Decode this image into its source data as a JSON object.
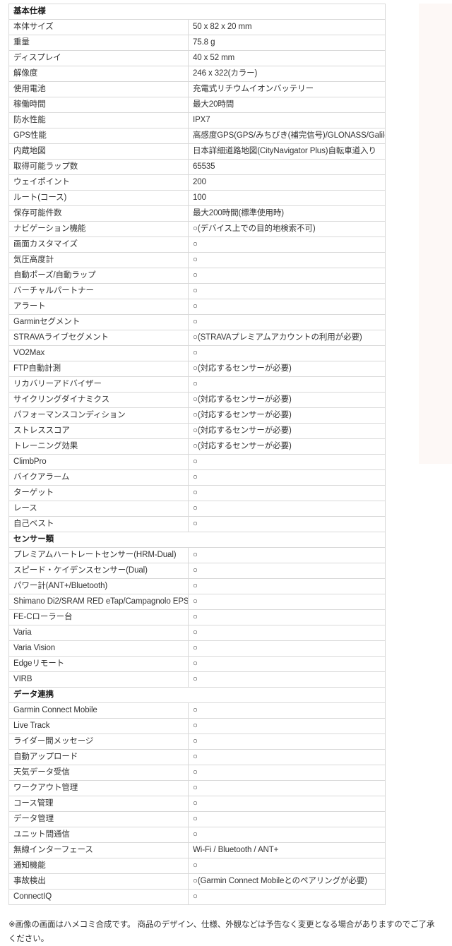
{
  "table": {
    "sections": [
      {
        "header": "基本仕様",
        "rows": [
          {
            "label": "本体サイズ",
            "value": "50 x 82 x 20 mm"
          },
          {
            "label": "重量",
            "value": "75.8 g"
          },
          {
            "label": "ディスプレイ",
            "value": "40 x 52 mm"
          },
          {
            "label": "解像度",
            "value": "246 x 322(カラー)"
          },
          {
            "label": "使用電池",
            "value": "充電式リチウムイオンバッテリー"
          },
          {
            "label": "稼働時間",
            "value": "最大20時間"
          },
          {
            "label": "防水性能",
            "value": "IPX7"
          },
          {
            "label": "GPS性能",
            "value": "高感度GPS(GPS/みちびき(補完信号)/GLONASS/Galileo)"
          },
          {
            "label": "内蔵地図",
            "value": "日本詳細道路地図(CityNavigator Plus)自転車道入り"
          },
          {
            "label": "取得可能ラップ数",
            "value": "65535"
          },
          {
            "label": "ウェイポイント",
            "value": "200"
          },
          {
            "label": "ルート(コース)",
            "value": "100"
          },
          {
            "label": "保存可能件数",
            "value": "最大200時間(標準使用時)"
          },
          {
            "label": "ナビゲーション機能",
            "value": "○(デバイス上での目的地検索不可)"
          },
          {
            "label": "画面カスタマイズ",
            "value": "○"
          },
          {
            "label": "気圧高度計",
            "value": "○"
          },
          {
            "label": "自動ポーズ/自動ラップ",
            "value": "○"
          },
          {
            "label": "バーチャルパートナー",
            "value": "○"
          },
          {
            "label": "アラート",
            "value": "○"
          },
          {
            "label": "Garminセグメント",
            "value": "○"
          },
          {
            "label": "STRAVAライブセグメント",
            "value": "○(STRAVAプレミアムアカウントの利用が必要)"
          },
          {
            "label": "VO2Max",
            "value": "○"
          },
          {
            "label": "FTP自動計測",
            "value": "○(対応するセンサーが必要)"
          },
          {
            "label": "リカバリーアドバイザー",
            "value": "○"
          },
          {
            "label": "サイクリングダイナミクス",
            "value": "○(対応するセンサーが必要)"
          },
          {
            "label": "パフォーマンスコンディション",
            "value": "○(対応するセンサーが必要)"
          },
          {
            "label": "ストレススコア",
            "value": "○(対応するセンサーが必要)"
          },
          {
            "label": "トレーニング効果",
            "value": "○(対応するセンサーが必要)"
          },
          {
            "label": "ClimbPro",
            "value": "○"
          },
          {
            "label": "バイクアラーム",
            "value": "○"
          },
          {
            "label": "ターゲット",
            "value": "○"
          },
          {
            "label": "レース",
            "value": "○"
          },
          {
            "label": "自己ベスト",
            "value": "○"
          }
        ]
      },
      {
        "header": "センサー類",
        "rows": [
          {
            "label": "プレミアムハートレートセンサー(HRM-Dual)",
            "value": "○"
          },
          {
            "label": "スピード・ケイデンスセンサー(Dual)",
            "value": "○"
          },
          {
            "label": "パワー計(ANT+/Bluetooth)",
            "value": "○"
          },
          {
            "label": "Shimano Di2/SRAM RED eTap/Campagnolo EPS",
            "value": "○"
          },
          {
            "label": "FE-Cローラー台",
            "value": "○"
          },
          {
            "label": "Varia",
            "value": "○"
          },
          {
            "label": "Varia Vision",
            "value": "○"
          },
          {
            "label": "Edgeリモート",
            "value": "○"
          },
          {
            "label": "VIRB",
            "value": "○"
          }
        ]
      },
      {
        "header": "データ連携",
        "rows": [
          {
            "label": "Garmin Connect Mobile",
            "value": "○"
          },
          {
            "label": "Live Track",
            "value": "○"
          },
          {
            "label": "ライダー間メッセージ",
            "value": "○"
          },
          {
            "label": "自動アップロード",
            "value": "○"
          },
          {
            "label": "天気データ受信",
            "value": "○"
          },
          {
            "label": "ワークアウト管理",
            "value": "○"
          },
          {
            "label": "コース管理",
            "value": "○"
          },
          {
            "label": "データ管理",
            "value": "○"
          },
          {
            "label": "ユニット間通信",
            "value": "○"
          },
          {
            "label": "無線インターフェース",
            "value": "Wi-Fi / Bluetooth / ANT+"
          },
          {
            "label": "通知機能",
            "value": "○"
          },
          {
            "label": "事故検出",
            "value": "○(Garmin Connect Mobileとのペアリングが必要)"
          },
          {
            "label": "ConnectIQ",
            "value": "○"
          }
        ]
      }
    ]
  },
  "footnote": "※画像の画面はハメコミ合成です。 商品のデザイン、仕様、外観などは予告なく変更となる場合がありますのでご了承ください。",
  "colors": {
    "border": "#d9d9d9",
    "text": "#333333",
    "tint": "#fdf8f6",
    "background": "#ffffff"
  }
}
